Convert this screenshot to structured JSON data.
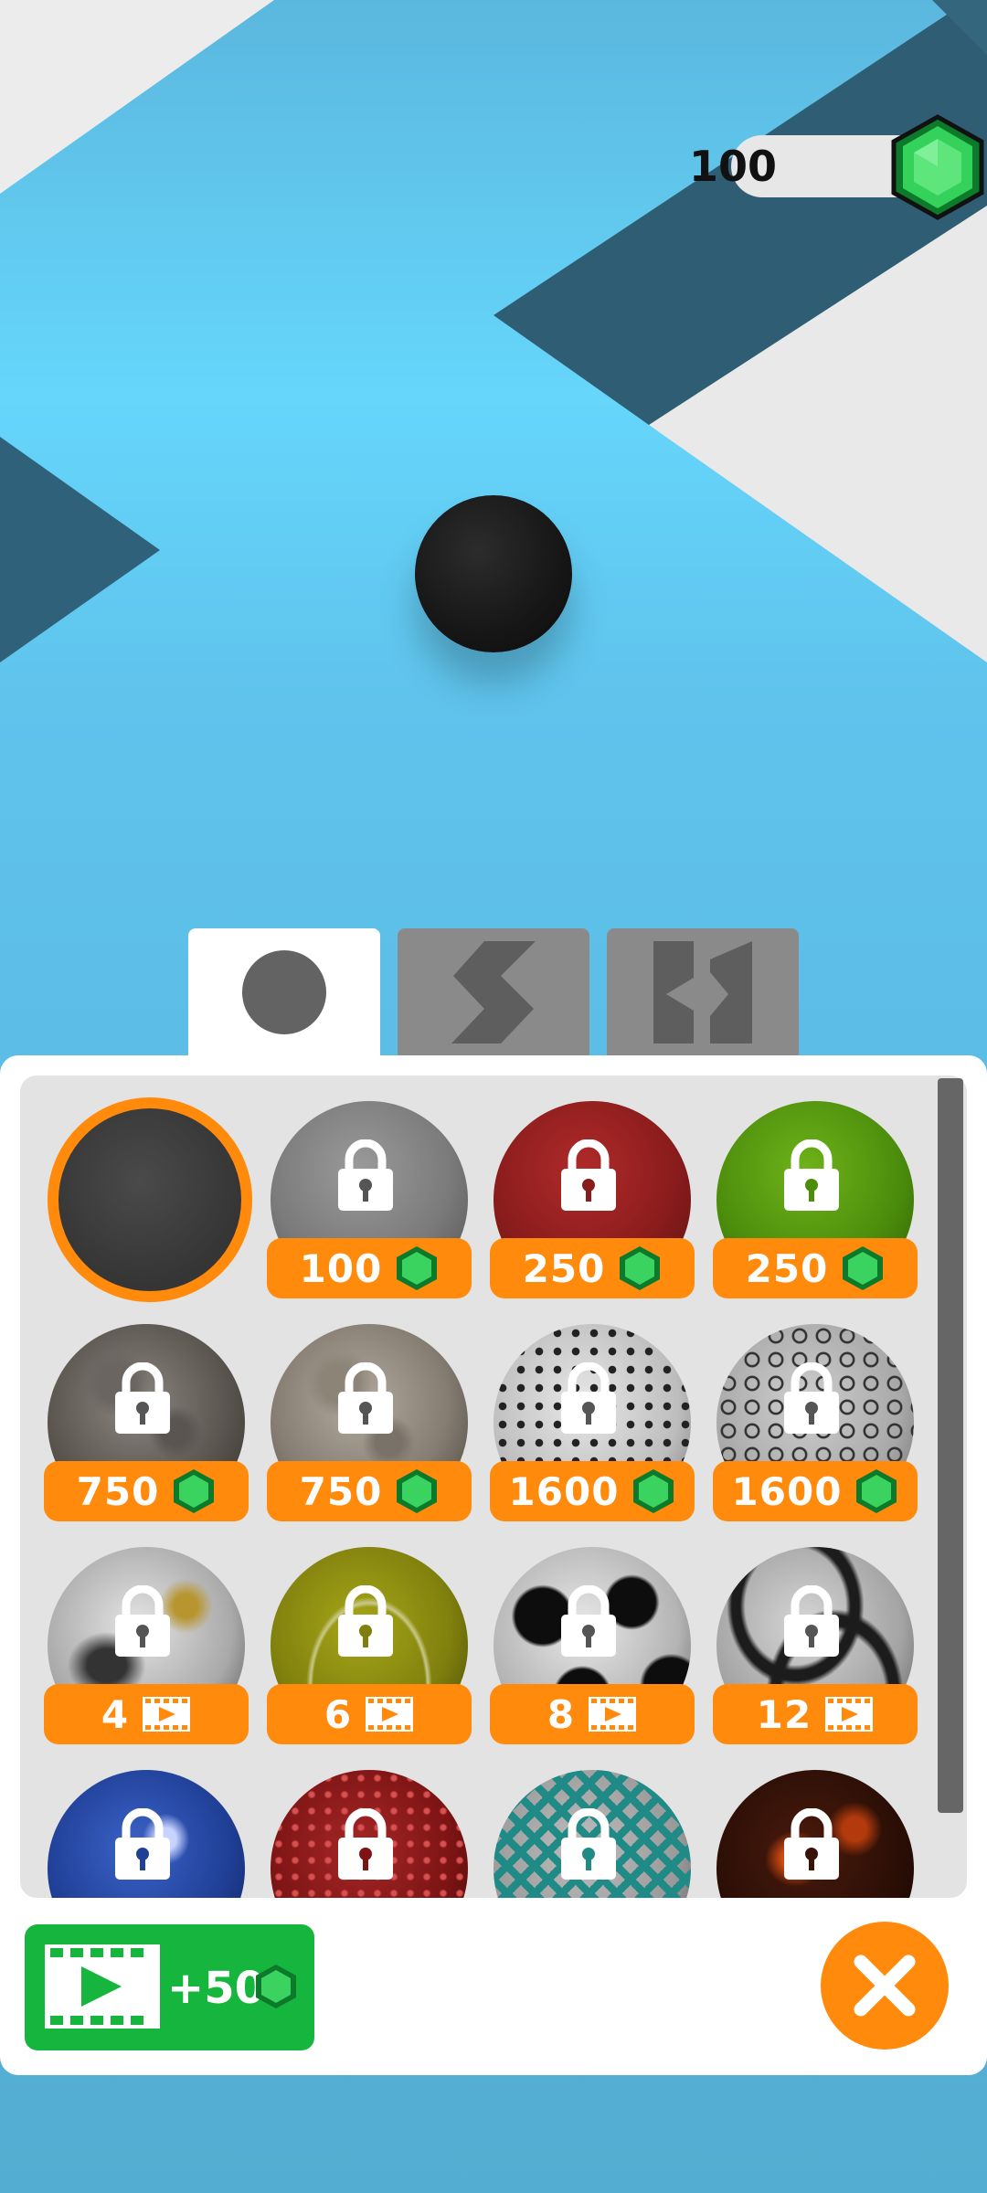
{
  "gems": {
    "count": "100",
    "icon": "gem-icon",
    "color": "#2fce4f"
  },
  "tabs": [
    {
      "name": "balls",
      "icon": "ball-tab-icon",
      "active": true
    },
    {
      "name": "paths",
      "icon": "zigzag-path-tab-icon",
      "active": false
    },
    {
      "name": "walls",
      "icon": "wall-tab-icon",
      "active": false
    }
  ],
  "balls": [
    {
      "style": "dark-gray",
      "selected": true,
      "price": "",
      "currency": ""
    },
    {
      "style": "gray",
      "locked": true,
      "price": "100",
      "currency": "gem"
    },
    {
      "style": "red",
      "locked": true,
      "price": "250",
      "currency": "gem"
    },
    {
      "style": "green",
      "locked": true,
      "price": "250",
      "currency": "gem"
    },
    {
      "style": "moon-dark",
      "locked": true,
      "price": "750",
      "currency": "gem"
    },
    {
      "style": "moon-light",
      "locked": true,
      "price": "750",
      "currency": "gem"
    },
    {
      "style": "golf-dots",
      "locked": true,
      "price": "1600",
      "currency": "gem"
    },
    {
      "style": "gray-rings",
      "locked": true,
      "price": "1600",
      "currency": "gem"
    },
    {
      "style": "soccer-gold",
      "locked": true,
      "price": "4",
      "currency": "video"
    },
    {
      "style": "tennis",
      "locked": true,
      "price": "6",
      "currency": "video"
    },
    {
      "style": "soccer",
      "locked": true,
      "price": "8",
      "currency": "video"
    },
    {
      "style": "swirl",
      "locked": true,
      "price": "12",
      "currency": "video"
    },
    {
      "style": "blue-lightning",
      "locked": true,
      "price": "",
      "currency": ""
    },
    {
      "style": "red-scales",
      "locked": true,
      "price": "",
      "currency": ""
    },
    {
      "style": "teal-net",
      "locked": true,
      "price": "",
      "currency": ""
    },
    {
      "style": "lava",
      "locked": true,
      "price": "",
      "currency": ""
    }
  ],
  "video_reward": {
    "label": "+50",
    "icon": "video-icon"
  },
  "close": {
    "icon": "close-icon"
  },
  "colors": {
    "accent": "#ff8a0b",
    "video_green": "#16b53d",
    "sky": "#63d3f7"
  }
}
